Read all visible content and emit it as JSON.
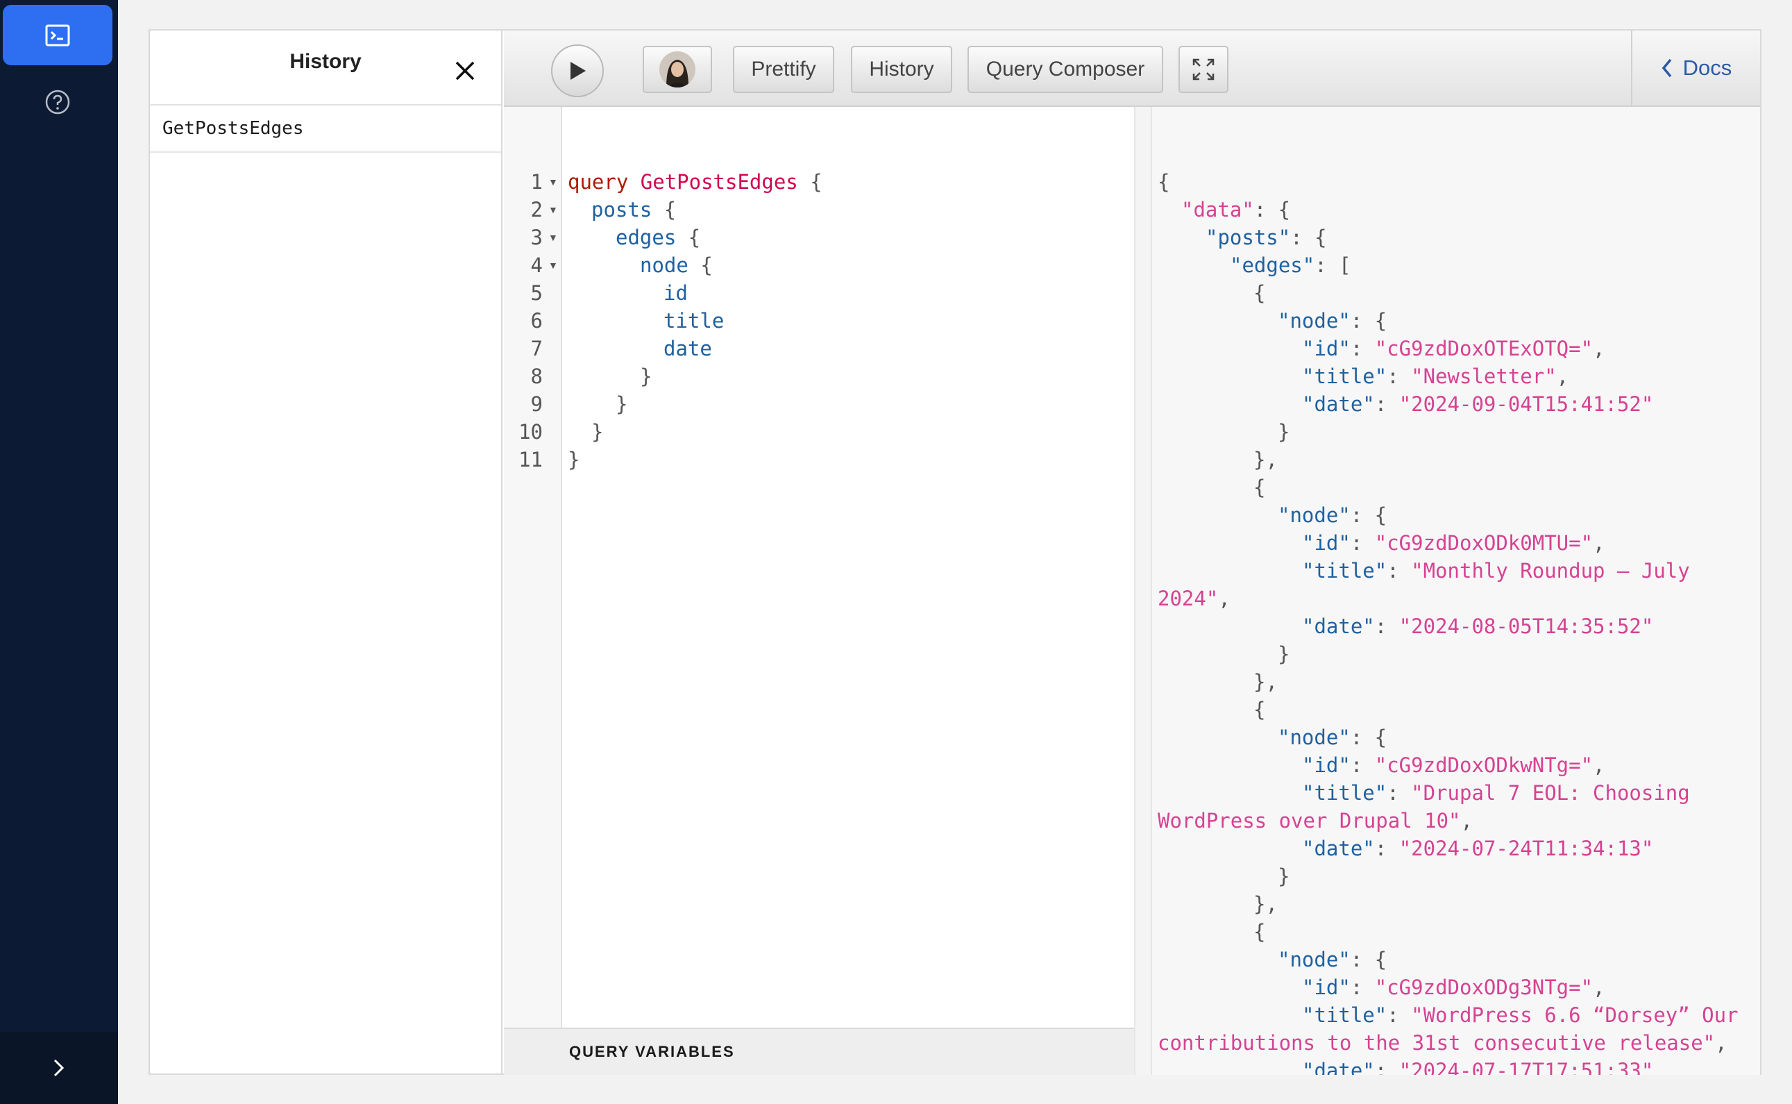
{
  "sidebar": {
    "items": [
      {
        "name": "terminal-icon",
        "active": true
      },
      {
        "name": "help-icon",
        "active": false
      }
    ],
    "expand_icon": "chevron-right-icon"
  },
  "history_panel": {
    "title": "History",
    "items": [
      "GetPostsEdges"
    ]
  },
  "toolbar": {
    "prettify_label": "Prettify",
    "history_label": "History",
    "composer_label": "Query Composer",
    "docs_label": "Docs"
  },
  "editor": {
    "line_numbers": [
      "1",
      "2",
      "3",
      "4",
      "5",
      "6",
      "7",
      "8",
      "9",
      "10",
      "11"
    ],
    "query_variables_label": "QUERY VARIABLES",
    "tokens": {
      "query_kw": "query",
      "op_name": "GetPostsEdges",
      "posts": "posts",
      "edges": "edges",
      "node": "node",
      "id": "id",
      "title": "title",
      "date": "date"
    }
  },
  "result": {
    "keys": {
      "data": "\"data\"",
      "posts": "\"posts\"",
      "edges": "\"edges\"",
      "node": "\"node\"",
      "id": "\"id\"",
      "title": "\"title\"",
      "date": "\"date\""
    },
    "edges": [
      {
        "id": "\"cG9zdDoxOTExOTQ=\"",
        "title": "\"Newsletter\"",
        "date": "\"2024-09-04T15:41:52\""
      },
      {
        "id": "\"cG9zdDoxODk0MTU=\"",
        "title_1": "\"Monthly Roundup – July",
        "title_2": "2024\"",
        "date": "\"2024-08-05T14:35:52\""
      },
      {
        "id": "\"cG9zdDoxODkwNTg=\"",
        "title_1": "\"Drupal 7 EOL: Choosing",
        "title_2": "WordPress over Drupal 10\"",
        "date": "\"2024-07-24T11:34:13\""
      },
      {
        "id": "\"cG9zdDoxODg3NTg=\"",
        "title_1": "\"WordPress 6.6 “Dorsey” Our",
        "title_2": "contributions to the 31st consecutive release\"",
        "date": "\"2024-07-17T17:51:33\""
      }
    ]
  }
}
